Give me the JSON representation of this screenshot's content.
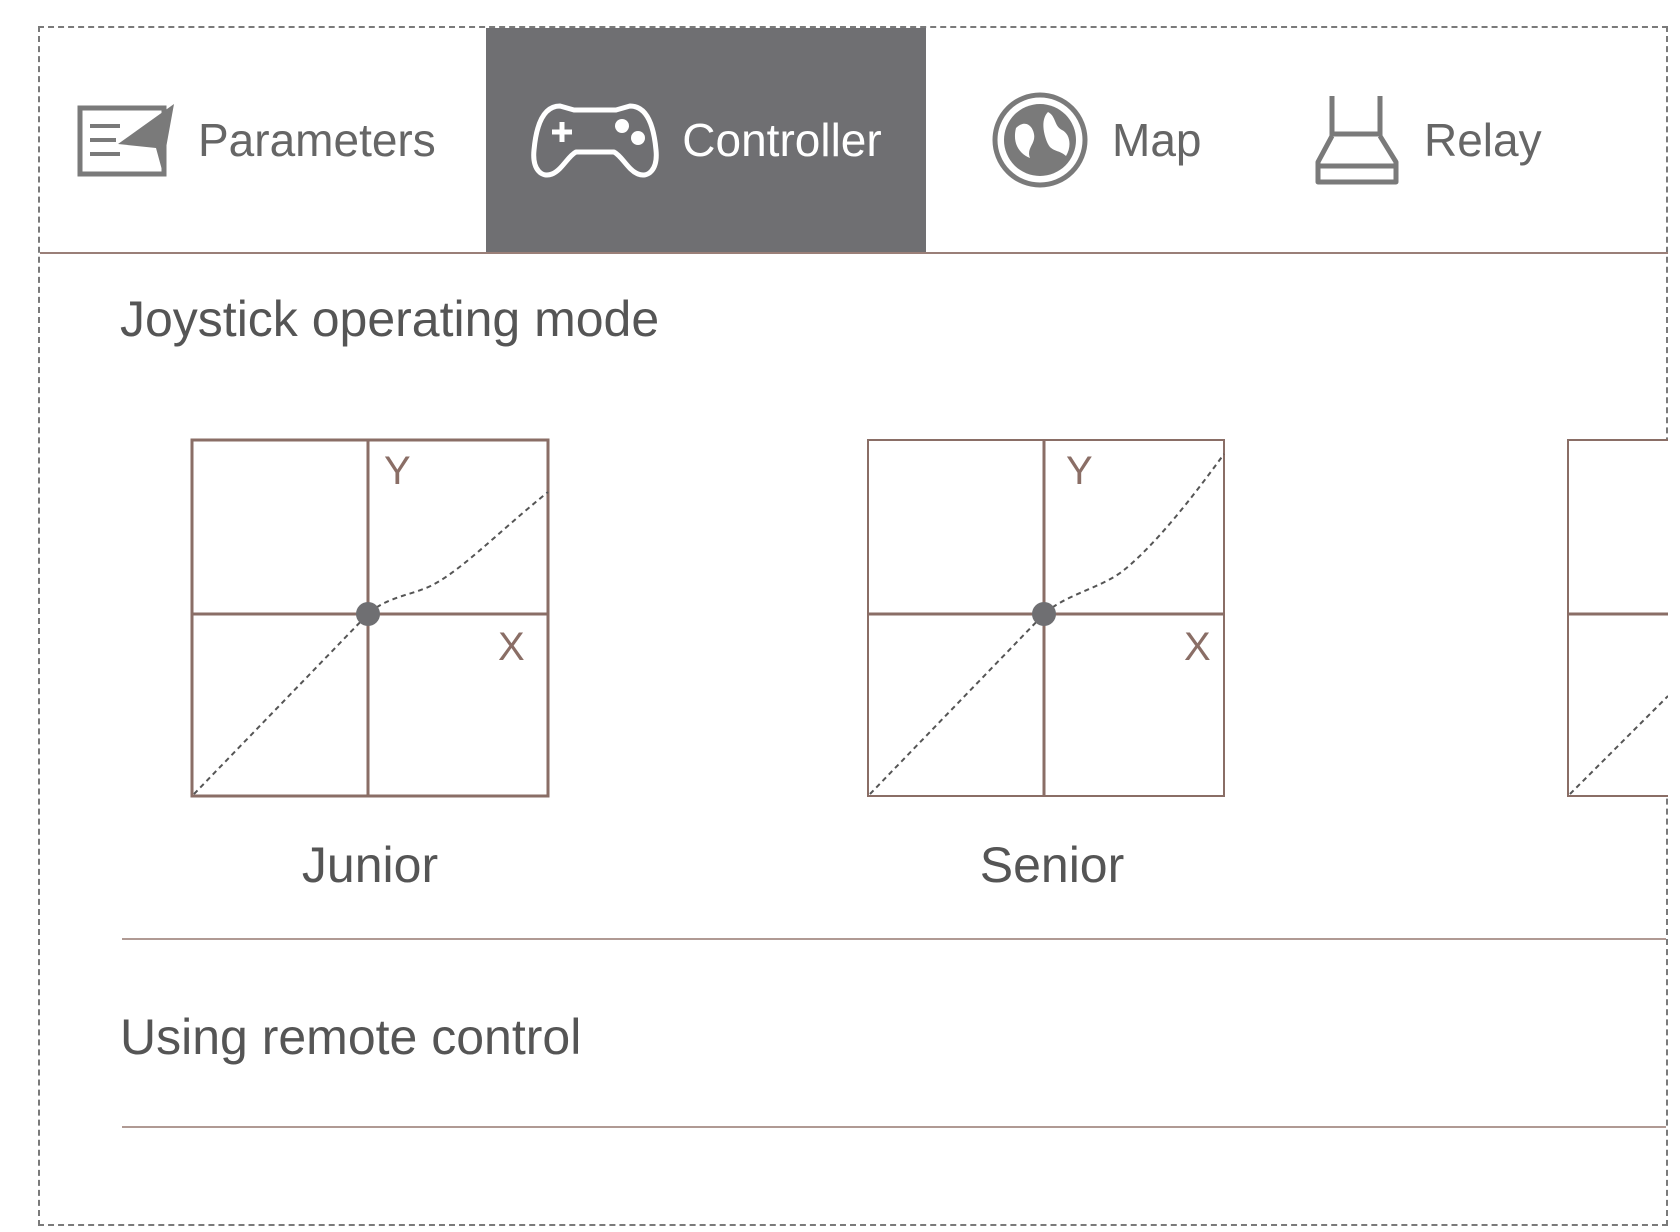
{
  "tabs": [
    {
      "id": "parameters",
      "label": "Parameters",
      "icon": "parameters-icon",
      "active": false
    },
    {
      "id": "controller",
      "label": "Controller",
      "icon": "gamepad-icon",
      "active": true
    },
    {
      "id": "map",
      "label": "Map",
      "icon": "globe-icon",
      "active": false
    },
    {
      "id": "relay",
      "label": "Relay",
      "icon": "router-icon",
      "active": false
    }
  ],
  "joystick": {
    "title": "Joystick operating mode",
    "modes": [
      {
        "label": "Junior",
        "axis_x": "X",
        "axis_y": "Y"
      },
      {
        "label": "Senior",
        "axis_x": "X",
        "axis_y": "Y"
      }
    ]
  },
  "remote": {
    "title": "Using remote control"
  },
  "colors": {
    "active_tab": "#6f6f72",
    "axis": "#8a6e66",
    "divider": "#b09a94",
    "text": "#555555"
  }
}
